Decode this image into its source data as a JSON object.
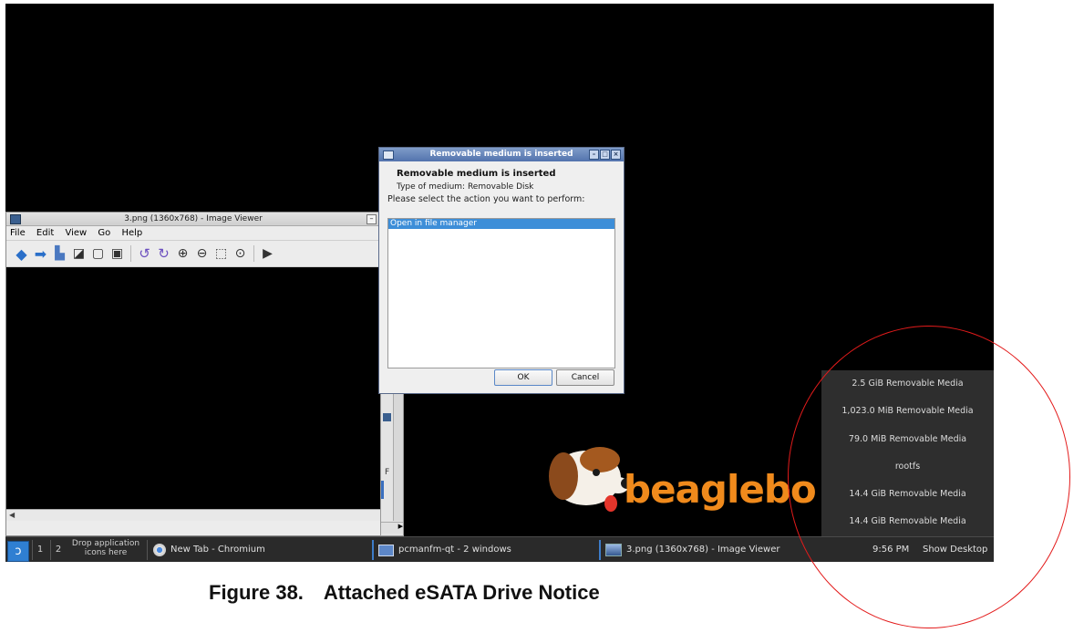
{
  "image_viewer": {
    "title": "3.png (1360x768) - Image Viewer",
    "menu": [
      "File",
      "Edit",
      "View",
      "Go",
      "Help"
    ],
    "toolbar_icons": [
      "back-arrow-icon",
      "forward-arrow-icon",
      "open-file-icon",
      "save-icon",
      "copy-icon",
      "paste-icon",
      "rotate-left-icon",
      "rotate-right-icon",
      "zoom-in-icon",
      "zoom-out-icon",
      "fit-window-icon",
      "original-size-icon",
      "slideshow-icon"
    ],
    "minimize_glyph": "–"
  },
  "dialog": {
    "title": "Removable medium is inserted",
    "heading": "Removable medium is inserted",
    "medium_type": "Type of medium:  Removable Disk",
    "prompt": "Please select the action you want to perform:",
    "options": [
      "Open in file manager"
    ],
    "ok_label": "OK",
    "cancel_label": "Cancel",
    "window_buttons": [
      "–",
      "□",
      "×"
    ]
  },
  "background_window": {
    "fragment_letter": "F"
  },
  "logo": {
    "text": "beaglebo"
  },
  "mount_menu": {
    "items": [
      "2.5 GiB Removable Media",
      "1,023.0 MiB Removable Media",
      "79.0 MiB Removable Media",
      "rootfs",
      "14.4 GiB Removable Media",
      "14.4 GiB Removable Media"
    ]
  },
  "taskbar": {
    "start_glyph": "ↄ",
    "workspaces": [
      "1",
      "2"
    ],
    "drop_hint_line1": "Drop application",
    "drop_hint_line2": "icons here",
    "tasks": [
      {
        "label": "New Tab - Chromium"
      },
      {
        "label": "pcmanfm-qt - 2 windows"
      },
      {
        "label": "3.png (1360x768) - Image Viewer"
      }
    ],
    "clock": "9:56 PM",
    "show_desktop": "Show Desktop"
  },
  "caption": {
    "number": "Figure 38.",
    "text": "Attached eSATA Drive Notice"
  },
  "colors": {
    "desktop": "#000000",
    "selection": "#3d8ed8",
    "logo_orange": "#f08a1c",
    "annotation_red": "#e31b1b"
  }
}
